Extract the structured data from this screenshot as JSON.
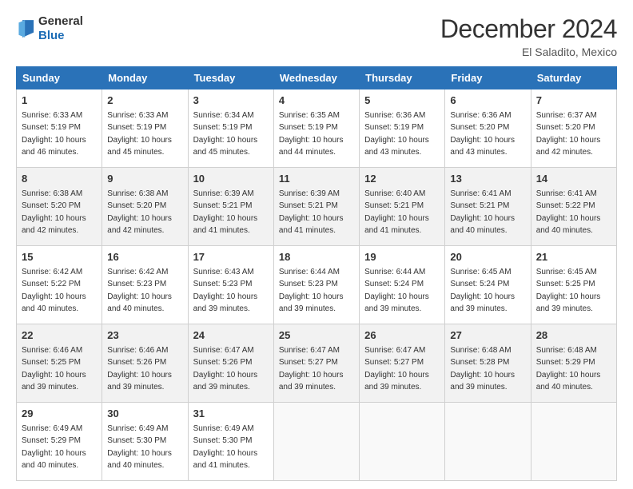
{
  "header": {
    "logo": {
      "general": "General",
      "blue": "Blue"
    },
    "title": "December 2024",
    "location": "El Saladito, Mexico"
  },
  "calendar": {
    "weekdays": [
      "Sunday",
      "Monday",
      "Tuesday",
      "Wednesday",
      "Thursday",
      "Friday",
      "Saturday"
    ],
    "weeks": [
      [
        {
          "day": 1,
          "sunrise": "6:33 AM",
          "sunset": "5:19 PM",
          "daylight": "10 hours and 46 minutes."
        },
        {
          "day": 2,
          "sunrise": "6:33 AM",
          "sunset": "5:19 PM",
          "daylight": "10 hours and 45 minutes."
        },
        {
          "day": 3,
          "sunrise": "6:34 AM",
          "sunset": "5:19 PM",
          "daylight": "10 hours and 45 minutes."
        },
        {
          "day": 4,
          "sunrise": "6:35 AM",
          "sunset": "5:19 PM",
          "daylight": "10 hours and 44 minutes."
        },
        {
          "day": 5,
          "sunrise": "6:36 AM",
          "sunset": "5:19 PM",
          "daylight": "10 hours and 43 minutes."
        },
        {
          "day": 6,
          "sunrise": "6:36 AM",
          "sunset": "5:20 PM",
          "daylight": "10 hours and 43 minutes."
        },
        {
          "day": 7,
          "sunrise": "6:37 AM",
          "sunset": "5:20 PM",
          "daylight": "10 hours and 42 minutes."
        }
      ],
      [
        {
          "day": 8,
          "sunrise": "6:38 AM",
          "sunset": "5:20 PM",
          "daylight": "10 hours and 42 minutes."
        },
        {
          "day": 9,
          "sunrise": "6:38 AM",
          "sunset": "5:20 PM",
          "daylight": "10 hours and 42 minutes."
        },
        {
          "day": 10,
          "sunrise": "6:39 AM",
          "sunset": "5:21 PM",
          "daylight": "10 hours and 41 minutes."
        },
        {
          "day": 11,
          "sunrise": "6:39 AM",
          "sunset": "5:21 PM",
          "daylight": "10 hours and 41 minutes."
        },
        {
          "day": 12,
          "sunrise": "6:40 AM",
          "sunset": "5:21 PM",
          "daylight": "10 hours and 41 minutes."
        },
        {
          "day": 13,
          "sunrise": "6:41 AM",
          "sunset": "5:21 PM",
          "daylight": "10 hours and 40 minutes."
        },
        {
          "day": 14,
          "sunrise": "6:41 AM",
          "sunset": "5:22 PM",
          "daylight": "10 hours and 40 minutes."
        }
      ],
      [
        {
          "day": 15,
          "sunrise": "6:42 AM",
          "sunset": "5:22 PM",
          "daylight": "10 hours and 40 minutes."
        },
        {
          "day": 16,
          "sunrise": "6:42 AM",
          "sunset": "5:23 PM",
          "daylight": "10 hours and 40 minutes."
        },
        {
          "day": 17,
          "sunrise": "6:43 AM",
          "sunset": "5:23 PM",
          "daylight": "10 hours and 39 minutes."
        },
        {
          "day": 18,
          "sunrise": "6:44 AM",
          "sunset": "5:23 PM",
          "daylight": "10 hours and 39 minutes."
        },
        {
          "day": 19,
          "sunrise": "6:44 AM",
          "sunset": "5:24 PM",
          "daylight": "10 hours and 39 minutes."
        },
        {
          "day": 20,
          "sunrise": "6:45 AM",
          "sunset": "5:24 PM",
          "daylight": "10 hours and 39 minutes."
        },
        {
          "day": 21,
          "sunrise": "6:45 AM",
          "sunset": "5:25 PM",
          "daylight": "10 hours and 39 minutes."
        }
      ],
      [
        {
          "day": 22,
          "sunrise": "6:46 AM",
          "sunset": "5:25 PM",
          "daylight": "10 hours and 39 minutes."
        },
        {
          "day": 23,
          "sunrise": "6:46 AM",
          "sunset": "5:26 PM",
          "daylight": "10 hours and 39 minutes."
        },
        {
          "day": 24,
          "sunrise": "6:47 AM",
          "sunset": "5:26 PM",
          "daylight": "10 hours and 39 minutes."
        },
        {
          "day": 25,
          "sunrise": "6:47 AM",
          "sunset": "5:27 PM",
          "daylight": "10 hours and 39 minutes."
        },
        {
          "day": 26,
          "sunrise": "6:47 AM",
          "sunset": "5:27 PM",
          "daylight": "10 hours and 39 minutes."
        },
        {
          "day": 27,
          "sunrise": "6:48 AM",
          "sunset": "5:28 PM",
          "daylight": "10 hours and 39 minutes."
        },
        {
          "day": 28,
          "sunrise": "6:48 AM",
          "sunset": "5:29 PM",
          "daylight": "10 hours and 40 minutes."
        }
      ],
      [
        {
          "day": 29,
          "sunrise": "6:49 AM",
          "sunset": "5:29 PM",
          "daylight": "10 hours and 40 minutes."
        },
        {
          "day": 30,
          "sunrise": "6:49 AM",
          "sunset": "5:30 PM",
          "daylight": "10 hours and 40 minutes."
        },
        {
          "day": 31,
          "sunrise": "6:49 AM",
          "sunset": "5:30 PM",
          "daylight": "10 hours and 41 minutes."
        },
        null,
        null,
        null,
        null
      ]
    ]
  }
}
